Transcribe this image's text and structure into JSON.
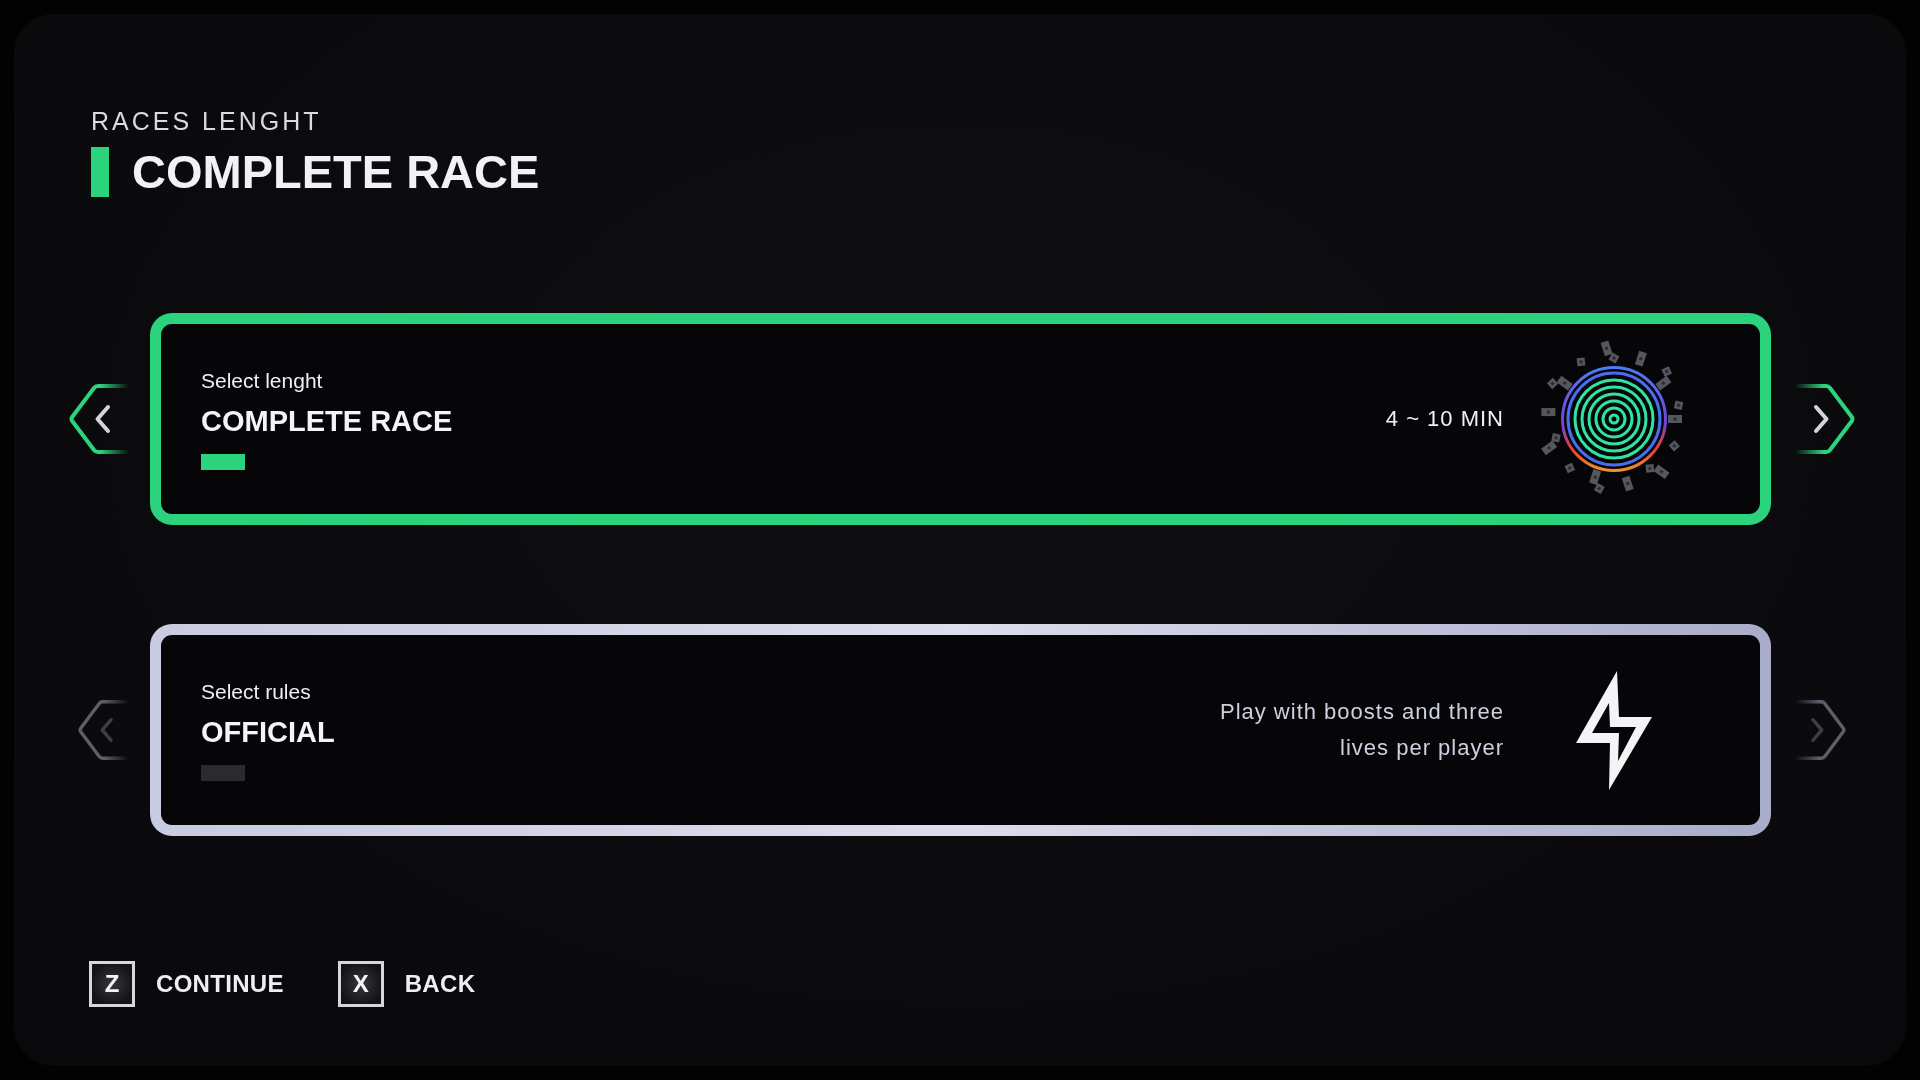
{
  "header": {
    "caption": "RACES LENGHT",
    "title": "COMPLETE RACE"
  },
  "options": [
    {
      "kind": "length",
      "selected": true,
      "label": "Select lenght",
      "value": "COMPLETE RACE",
      "detail": "4 ~ 10 MIN"
    },
    {
      "kind": "rules",
      "selected": false,
      "label": "Select rules",
      "value": "OFFICIAL",
      "detail": "Play with boosts and three lives per player"
    }
  ],
  "prompts": [
    {
      "key": "Z",
      "label": "CONTINUE"
    },
    {
      "key": "X",
      "label": "BACK"
    }
  ]
}
